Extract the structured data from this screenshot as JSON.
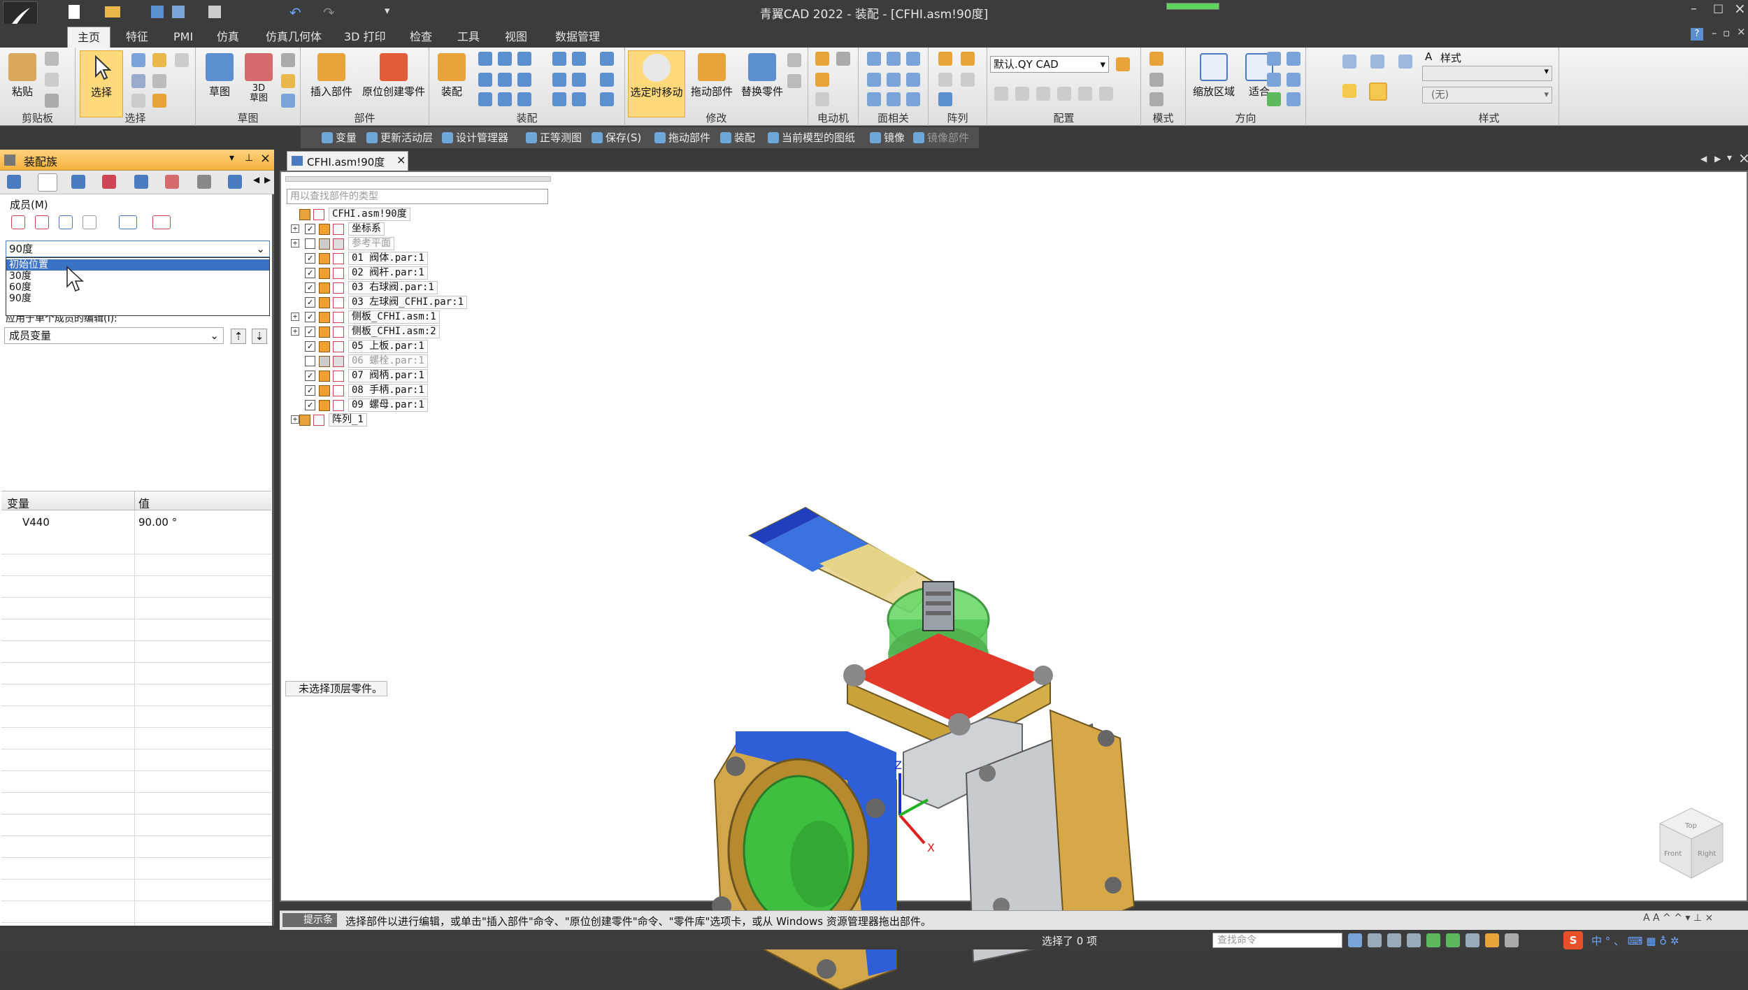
{
  "window": {
    "title": "青翼CAD 2022 - 装配 - [CFHI.asm!90度]",
    "controls": [
      "minimize-icon",
      "maximize-icon",
      "close-icon"
    ]
  },
  "ribbon_tabs": [
    "主页",
    "特征",
    "PMI",
    "仿真",
    "仿真几何体",
    "3D 打印",
    "检查",
    "工具",
    "视图",
    "数据管理"
  ],
  "active_tab": "主页",
  "ribbon": {
    "paste": "粘贴",
    "clipboard_group": "剪贴板",
    "select": "选择",
    "select_group": "选择",
    "sketch": "草图",
    "sketch3d": "3D\n草图",
    "sketch_group": "草图",
    "insert_part": "插入部件",
    "create_inplace": "原位创建零件",
    "part_group": "部件",
    "assemble": "装配",
    "assembly_group": "装配",
    "move_selected": "选定时移动",
    "drag_part": "拖动部件",
    "replace_part": "替换零件",
    "modify_group": "修改",
    "motor_group": "电动机",
    "face_group": "面相关",
    "array_group": "阵列",
    "config_value": "默认.QY CAD",
    "config_group": "配置",
    "mode_group": "模式",
    "zoom_area": "缩放区域",
    "fit": "适合",
    "orient_group": "方向",
    "style_label": "样式",
    "style_value": "(无)",
    "style_group": "样式"
  },
  "quick_bar": [
    "变量",
    "更新活动层",
    "设计管理器",
    "正等测图",
    "保存(S)",
    "拖动部件",
    "装配",
    "当前模型的图纸",
    "镜像",
    "镜像部件"
  ],
  "left_panel": {
    "title": "装配族",
    "members_label": "成员(M)",
    "dropdown_value": "90度",
    "dropdown_options": [
      "初始位置",
      "30度",
      "60度",
      "90度"
    ],
    "dropdown_selected_index": 0,
    "apply_label": "应用于单个成员的编辑(I):",
    "variant_value": "成员变量",
    "table_headers": [
      "变量",
      "值"
    ],
    "table_rows": [
      [
        "V440",
        "90.00 °"
      ]
    ]
  },
  "doc_tab": "CFHI.asm!90度",
  "search_placeholder": "用以查找部件的类型",
  "tree": [
    {
      "label": "CFHI.asm!90度",
      "level": 0,
      "expand": "",
      "checked": null,
      "dim": false
    },
    {
      "label": "坐标系",
      "level": 1,
      "expand": "+",
      "checked": true,
      "dim": false
    },
    {
      "label": "参考平面",
      "level": 1,
      "expand": "+",
      "checked": false,
      "dim": true
    },
    {
      "label": "01 阀体.par:1",
      "level": 1,
      "expand": "",
      "checked": true,
      "dim": false
    },
    {
      "label": "02 阀杆.par:1",
      "level": 1,
      "expand": "",
      "checked": true,
      "dim": false
    },
    {
      "label": "03 右球阀.par:1",
      "level": 1,
      "expand": "",
      "checked": true,
      "dim": false
    },
    {
      "label": "03 左球阀_CFHI.par:1",
      "level": 1,
      "expand": "",
      "checked": true,
      "dim": false
    },
    {
      "label": "侧板_CFHI.asm:1",
      "level": 1,
      "expand": "+",
      "checked": true,
      "dim": false
    },
    {
      "label": "侧板_CFHI.asm:2",
      "level": 1,
      "expand": "+",
      "checked": true,
      "dim": false
    },
    {
      "label": "05 上板.par:1",
      "level": 1,
      "expand": "",
      "checked": true,
      "dim": false
    },
    {
      "label": "06 螺栓.par:1",
      "level": 1,
      "expand": "",
      "checked": false,
      "dim": true
    },
    {
      "label": "07 阀柄.par:1",
      "level": 1,
      "expand": "",
      "checked": true,
      "dim": false
    },
    {
      "label": "08 手柄.par:1",
      "level": 1,
      "expand": "",
      "checked": true,
      "dim": false
    },
    {
      "label": "09 螺母.par:1",
      "level": 1,
      "expand": "",
      "checked": true,
      "dim": false
    },
    {
      "label": "阵列_1",
      "level": 0,
      "expand": "+",
      "checked": null,
      "dim": false
    }
  ],
  "tree_status": "未选择顶层零件。",
  "prompt": {
    "tag": "提示条",
    "text": "选择部件以进行编辑，或单击\"插入部件\"命令、\"原位创建零件\"命令、\"零件库\"选项卡，或从 Windows 资源管理器拖出部件。"
  },
  "status": {
    "selected": "选择了 0 项",
    "command_placeholder": "查找命令"
  },
  "viewcube": {
    "top": "Top",
    "front": "Front",
    "right": "Right"
  },
  "triad": {
    "z": "Z",
    "x": "X"
  }
}
